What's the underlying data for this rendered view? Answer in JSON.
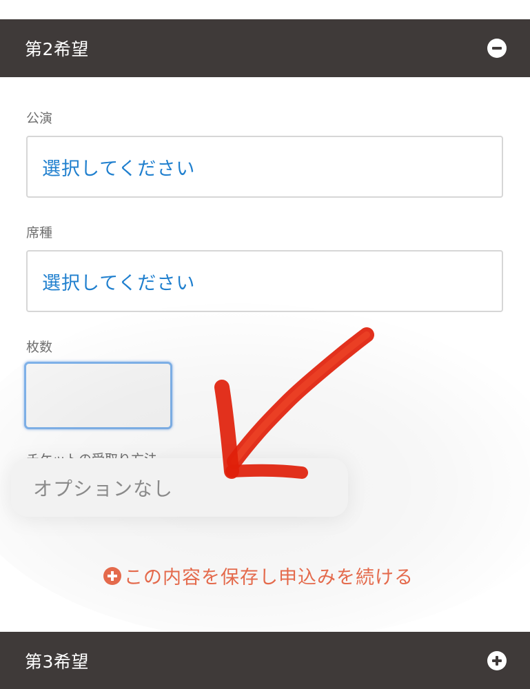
{
  "sections": {
    "second": {
      "title": "第2希望",
      "toggle_icon": "minus-circle-icon"
    },
    "third": {
      "title": "第3希望",
      "toggle_icon": "plus-circle-icon"
    }
  },
  "form": {
    "performance": {
      "label": "公演",
      "value": "選択してください"
    },
    "seat_type": {
      "label": "席種",
      "value": "選択してください"
    },
    "quantity": {
      "label": "枚数",
      "value": ""
    },
    "ticket_pickup": {
      "label": "チケットの受取り方法"
    }
  },
  "dropdown_option": {
    "label": "オプションなし"
  },
  "continue_link": {
    "label": "この内容を保存し申込みを続ける",
    "icon": "plus-circle-icon"
  },
  "annotation": {
    "type": "red-hand-drawn-arrow"
  },
  "colors": {
    "header_bg": "#3f3a39",
    "select_text": "#1f7fce",
    "link_text": "#e46a4c",
    "focus_border": "#7fb2ea",
    "annotation_red": "#e0200a"
  }
}
